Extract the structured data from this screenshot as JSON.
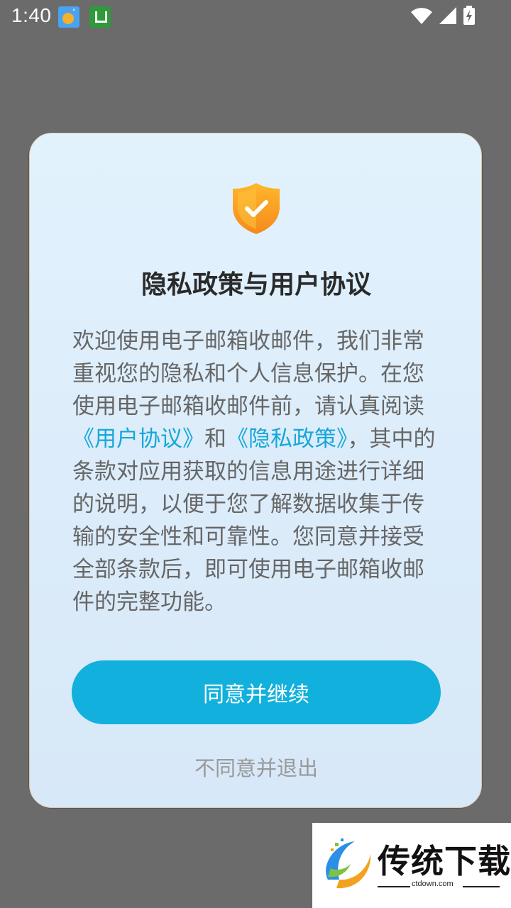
{
  "status_bar": {
    "time": "1:40",
    "icons": [
      "weather-icon",
      "app-notification-icon",
      "wifi-icon",
      "signal-icon",
      "battery-charging-icon"
    ]
  },
  "dialog": {
    "title": "隐私政策与用户协议",
    "body_part1": "欢迎使用电子邮箱收邮件，我们非常重视您的隐私和个人信息保护。在您使用电子邮箱收邮件前，请认真阅读",
    "link_user_agreement": "《用户协议》",
    "body_and": "和",
    "link_privacy_policy": "《隐私政策》",
    "body_part2": "，其中的条款对应用获取的信息用途进行详细的说明，以便于您了解数据收集于传输的安全性和可靠性。您同意并接受全部条款后，即可使用电子邮箱收邮件的完整功能。",
    "agree_label": "同意并继续",
    "decline_label": "不同意并退出"
  },
  "watermark": {
    "title": "传统下载",
    "url": "ctdown.com"
  },
  "colors": {
    "accent": "#12b0dc",
    "link": "#16a8d8",
    "overlay": "#6b6b6b",
    "shield_orange": "#f7a023"
  }
}
